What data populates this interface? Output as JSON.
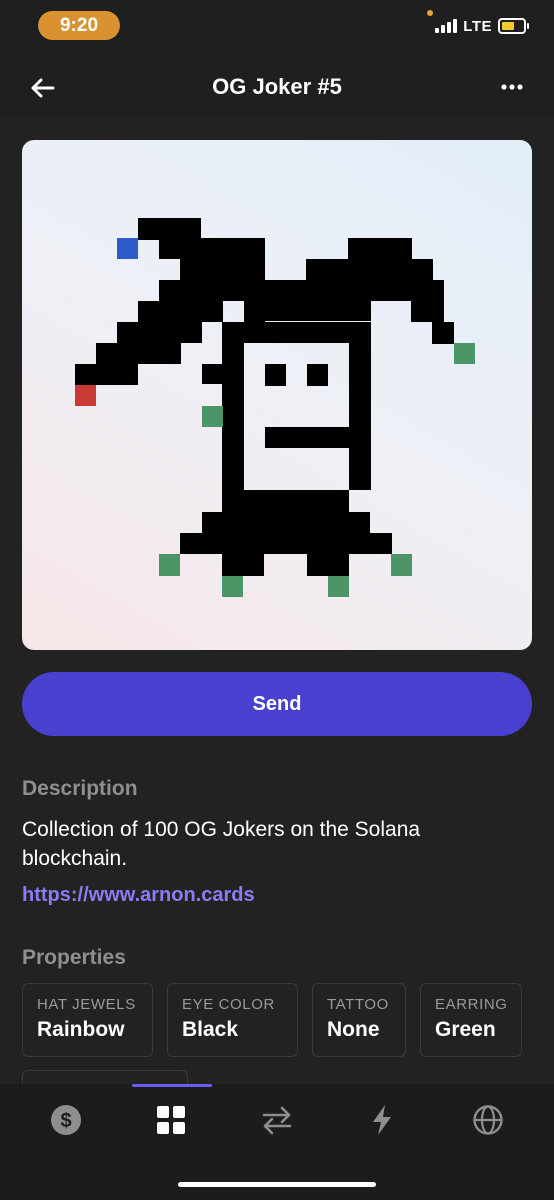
{
  "status": {
    "time": "9:20",
    "network": "LTE"
  },
  "header": {
    "title": "OG Joker #5"
  },
  "nft": {
    "name": "OG Joker #5"
  },
  "actions": {
    "send_label": "Send"
  },
  "description": {
    "heading": "Description",
    "text": "Collection of 100 OG Jokers on the Solana blockchain.",
    "link": "https://www.arnon.cards"
  },
  "properties": {
    "heading": "Properties",
    "items": [
      {
        "label": "HAT JEWELS",
        "value": "Rainbow"
      },
      {
        "label": "EYE COLOR",
        "value": "Black"
      },
      {
        "label": "TATTOO",
        "value": "None"
      },
      {
        "label": "EARRING",
        "value": "Green"
      }
    ]
  },
  "tabs": [
    {
      "icon": "dollar-icon",
      "active": false
    },
    {
      "icon": "grid-icon",
      "active": true
    },
    {
      "icon": "swap-icon",
      "active": false
    },
    {
      "icon": "lightning-icon",
      "active": false
    },
    {
      "icon": "globe-icon",
      "active": false
    }
  ],
  "colors": {
    "accent": "#4a40d0",
    "link": "#8a7cf5",
    "background": "#222222",
    "jewel_blue": "#2b5cc8",
    "jewel_red": "#c83a34",
    "jewel_green": "#4c9566"
  }
}
